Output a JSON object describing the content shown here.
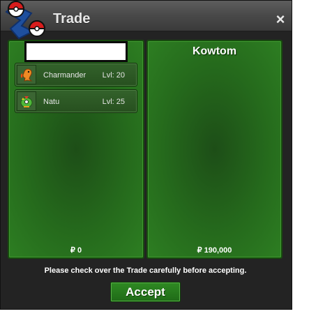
{
  "window": {
    "title": "Trade",
    "close_icon": "×"
  },
  "my_side": {
    "name": "",
    "pokemon": [
      {
        "name": "Charmander",
        "level": "Lvl: 20",
        "icon": "charmander-icon"
      },
      {
        "name": "Natu",
        "level": "Lvl: 25",
        "icon": "natu-icon"
      }
    ],
    "money": "₽ 0"
  },
  "partner_side": {
    "name": "Kowtom",
    "money": "₽ 190,000"
  },
  "notice": "Please check over the Trade carefully before accepting.",
  "accept_label": "Accept",
  "colors": {
    "panel_green": "#2d7e22",
    "title_bar": "#4a4a4a",
    "window_bg": "#232323"
  }
}
